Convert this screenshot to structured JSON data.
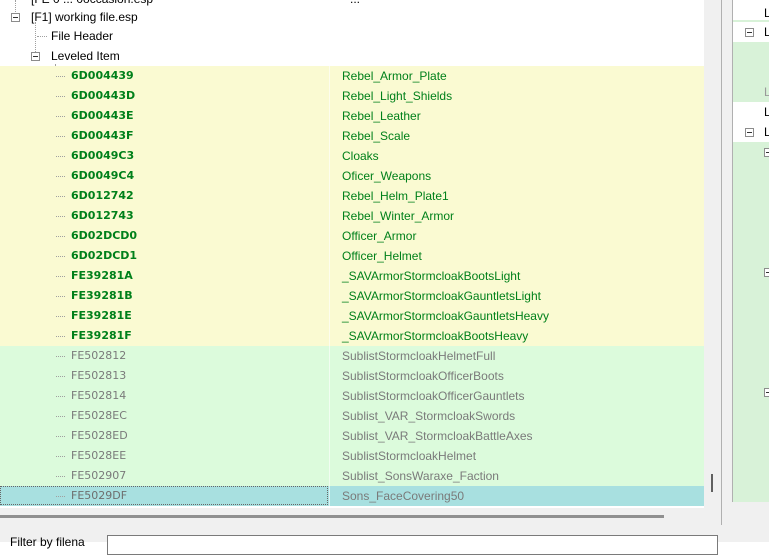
{
  "tree": {
    "partial_top_row": "[FE 0 ... 0occasion.esp",
    "partial_top_value": "...",
    "file_node": "[F1] working file.esp",
    "file_header": "File Header",
    "group_node": "Leveled Item"
  },
  "records": [
    {
      "id": "6D004439",
      "name": "Rebel_Armor_Plate",
      "state": "conflict"
    },
    {
      "id": "6D00443D",
      "name": "Rebel_Light_Shields",
      "state": "conflict"
    },
    {
      "id": "6D00443E",
      "name": "Rebel_Leather",
      "state": "conflict"
    },
    {
      "id": "6D00443F",
      "name": "Rebel_Scale",
      "state": "conflict"
    },
    {
      "id": "6D0049C3",
      "name": "Cloaks",
      "state": "conflict"
    },
    {
      "id": "6D0049C4",
      "name": "Oficer_Weapons",
      "state": "conflict"
    },
    {
      "id": "6D012742",
      "name": "Rebel_Helm_Plate1",
      "state": "conflict"
    },
    {
      "id": "6D012743",
      "name": "Rebel_Winter_Armor",
      "state": "conflict"
    },
    {
      "id": "6D02DCD0",
      "name": "Officer_Armor",
      "state": "conflict"
    },
    {
      "id": "6D02DCD1",
      "name": "Officer_Helmet",
      "state": "conflict"
    },
    {
      "id": "FE39281A",
      "name": "_SAVArmorStormcloakBootsLight",
      "state": "conflict"
    },
    {
      "id": "FE39281B",
      "name": "_SAVArmorStormcloakGauntletsLight",
      "state": "conflict"
    },
    {
      "id": "FE39281E",
      "name": "_SAVArmorStormcloakGauntletsHeavy",
      "state": "conflict"
    },
    {
      "id": "FE39281F",
      "name": "_SAVArmorStormcloakBootsHeavy",
      "state": "conflict"
    },
    {
      "id": "FE502812",
      "name": "SublistStormcloakHelmetFull",
      "state": "ok"
    },
    {
      "id": "FE502813",
      "name": "SublistStormcloakOfficerBoots",
      "state": "ok"
    },
    {
      "id": "FE502814",
      "name": "SublistStormcloakOfficerGauntlets",
      "state": "ok"
    },
    {
      "id": "FE5028EC",
      "name": "Sublist_VAR_StormcloakSwords",
      "state": "ok"
    },
    {
      "id": "FE5028ED",
      "name": "Sublist_VAR_StormcloakBattleAxes",
      "state": "ok"
    },
    {
      "id": "FE5028EE",
      "name": "SublistStormcloakHelmet",
      "state": "ok"
    },
    {
      "id": "FE502907",
      "name": "Sublist_SonsWaraxe_Faction",
      "state": "ok"
    },
    {
      "id": "FE5029DF",
      "name": "Sons_FaceCovering50",
      "state": "selected"
    }
  ],
  "right_panel": {
    "letter": "L",
    "letter_dim": "L"
  },
  "filter": {
    "label": "Filter by filena",
    "value": ""
  },
  "colors": {
    "conflict_bg": "#fafad2",
    "conflict_text": "#00801a",
    "ok_bg": "#dcfbdc",
    "ok_text": "#7a7a7a",
    "selected_bg": "#a8e0e0"
  }
}
